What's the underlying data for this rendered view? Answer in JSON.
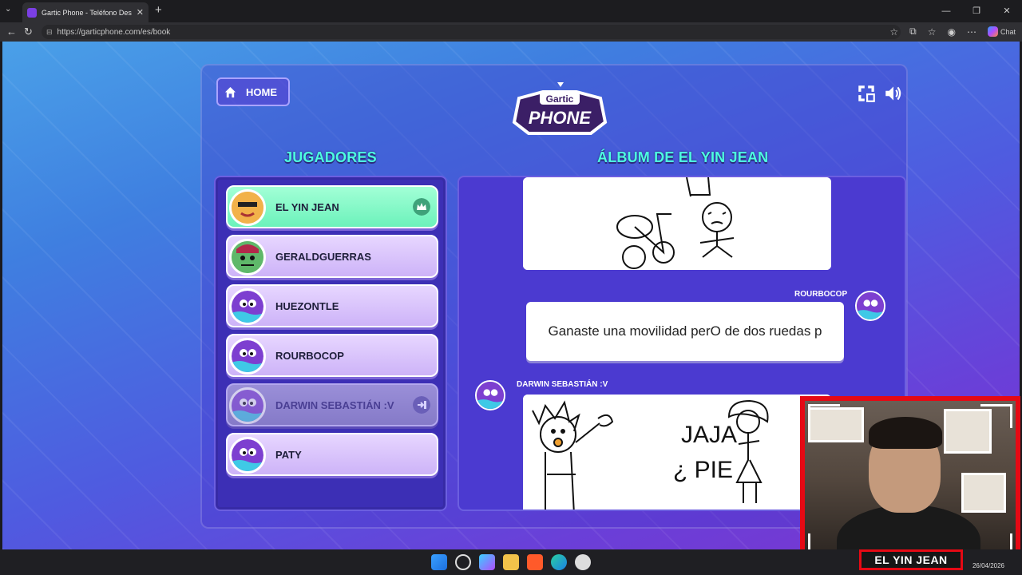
{
  "browser": {
    "tab_title": "Gartic Phone - Teléfono Descompuesto",
    "tab_close": "✕",
    "new_tab": "+",
    "url": "https://garticphone.com/es/book",
    "chat_label": "Chat",
    "window_controls": [
      "—",
      "❐",
      "✕"
    ]
  },
  "app": {
    "home_label": "HOME",
    "logo_text_top": "Gartic",
    "logo_text_bottom": "PHONE",
    "players_title": "JUGADORES",
    "album_title": "ÁLBUM DE EL YIN JEAN"
  },
  "players": [
    {
      "name": "EL YIN JEAN",
      "state": "host",
      "badge": "crown-icon"
    },
    {
      "name": "GERALDGUERRAS",
      "state": "active"
    },
    {
      "name": "HUEZONTLE",
      "state": "active"
    },
    {
      "name": "ROURBOCOP",
      "state": "active"
    },
    {
      "name": "DARWIN SEBASTIÁN :V",
      "state": "left",
      "badge": "exit-icon"
    },
    {
      "name": "PATY",
      "state": "active"
    }
  ],
  "album": {
    "phrase_author": "ROURBOCOP",
    "phrase_text": "Ganaste una movilidad perO de dos ruedas p",
    "drawing_author": "DARWIN SEBASTIÁN :V",
    "drawing_words": [
      "JAJA",
      "¿ PIE"
    ]
  },
  "stream_overlay": {
    "name": "EL YIN JEAN"
  },
  "taskbar": {
    "date": "26/04/2026"
  },
  "colors": {
    "accent_title": "#4dffe0",
    "host_card": "#6cf2bb",
    "player_card": "#cdb3f8",
    "webcam_border": "#e50914"
  }
}
